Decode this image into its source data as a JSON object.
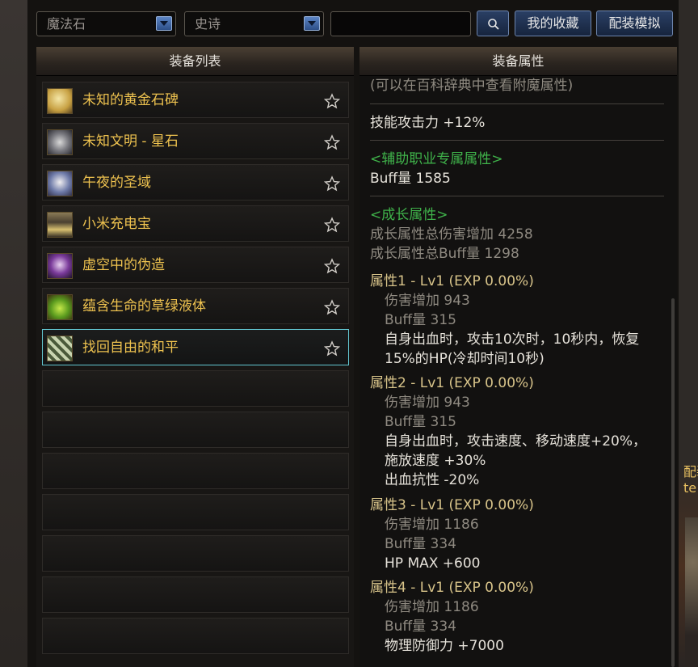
{
  "toolbar": {
    "type_select": "魔法石",
    "rarity_select": "史诗",
    "search_value": "",
    "favorites_label": "我的收藏",
    "simulate_label": "配装模拟"
  },
  "equipment_list": {
    "header": "装备列表",
    "items": [
      {
        "name": "未知的黄金石碑",
        "icon": "golden-tablet-icon"
      },
      {
        "name": "未知文明 - 星石",
        "icon": "star-stone-icon"
      },
      {
        "name": "午夜的圣域",
        "icon": "midnight-sanctuary-icon"
      },
      {
        "name": "小米充电宝",
        "icon": "power-bank-icon"
      },
      {
        "name": "虚空中的伪造",
        "icon": "void-forgery-icon"
      },
      {
        "name": "蕴含生命的草绿液体",
        "icon": "green-liquid-icon"
      },
      {
        "name": "找回自由的和平",
        "icon": "freedom-peace-icon"
      }
    ],
    "selected_index": 6
  },
  "attributes": {
    "header": "装备属性",
    "lines": [
      "(可以在百科辞典中查看附魔属性)",
      "技能攻击力  +12%",
      "<辅助职业专属属性>",
      "Buff量  1585",
      "<成长属性>",
      "成长属性总伤害增加 4258",
      "成长属性总Buff量 1298",
      "属性1 - Lv1 (EXP 0.00%)",
      "伤害增加  943",
      "Buff量  315",
      "自身出血时，攻击10次时，10秒内，恢复",
      "15%的HP(冷却时间10秒)",
      "属性2 - Lv1 (EXP 0.00%)",
      "伤害增加  943",
      "Buff量  315",
      "自身出血时，攻击速度、移动速度+20%，",
      "施放速度 +30%",
      "出血抗性 -20%",
      "属性3 - Lv1 (EXP 0.00%)",
      "伤害增加  1186",
      "Buff量  334",
      "HP MAX +600",
      "属性4 - Lv1 (EXP 0.00%)",
      "伤害增加  1186",
      "Buff量  334",
      "物理防御力 +7000"
    ]
  },
  "side_fragment": "配装\nte",
  "colors": {
    "item_name": "#eec24f",
    "green_header": "#3fb24a",
    "selected_border": "#62c6d0",
    "accent_button": "#16243d"
  }
}
